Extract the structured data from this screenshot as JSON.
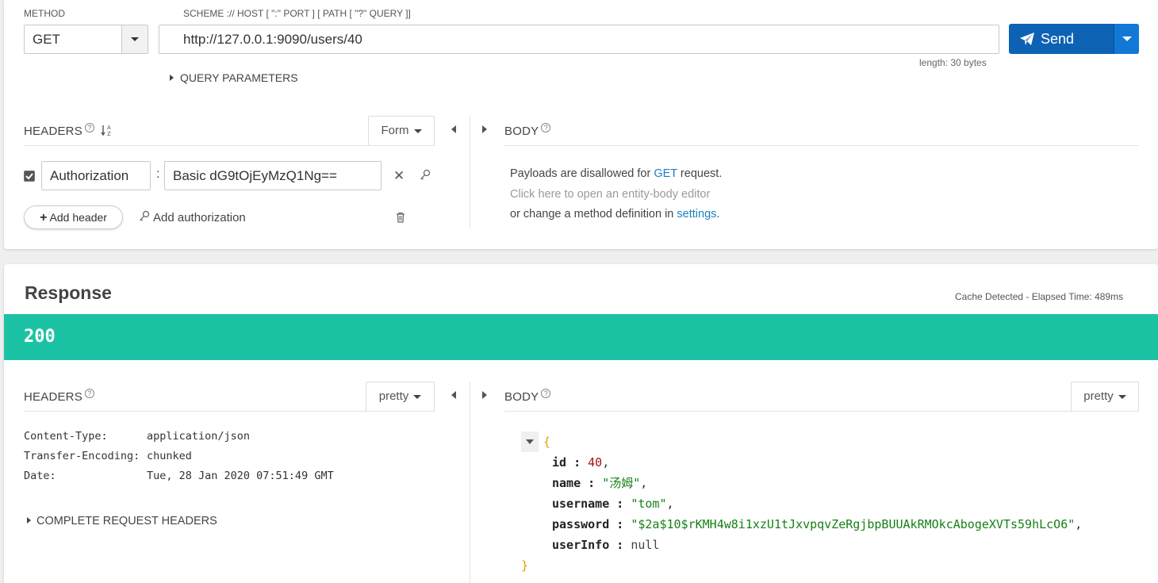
{
  "request": {
    "method_label": "METHOD",
    "method_value": "GET",
    "url_label": "SCHEME :// HOST [ \":\" PORT ] [ PATH [ \"?\" QUERY ]]",
    "url_value": "http://127.0.0.1:9090/users/40",
    "url_length": "length: 30 bytes",
    "send_label": "Send",
    "query_params_label": "QUERY PARAMETERS",
    "headers_title": "HEADERS",
    "headers_mode": "Form",
    "header_row": {
      "name": "Authorization",
      "separator": ":",
      "value": "Basic dG9tOjEyMzQ1Ng=="
    },
    "add_header_label": "Add header",
    "add_auth_label": "Add authorization",
    "body_title": "BODY",
    "body_msg": {
      "line1_pre": "Payloads are disallowed for ",
      "line1_method": "GET",
      "line1_post": " request.",
      "line2": "Click here to open an entity-body editor",
      "line3_pre": "or change a method definition in ",
      "line3_link": "settings",
      "line3_post": "."
    }
  },
  "response": {
    "title": "Response",
    "meta": "Cache Detected - Elapsed Time: 489ms",
    "status_code": "200",
    "status_color": "#1bc3a4",
    "headers_title": "HEADERS",
    "headers_mode": "pretty",
    "body_title": "BODY",
    "body_mode": "pretty",
    "headers": [
      {
        "name": "Content-Type:",
        "value": "application/json"
      },
      {
        "name": "Transfer-Encoding:",
        "value": "chunked"
      },
      {
        "name": "Date:",
        "value": "Tue, 28 Jan 2020 07:51:49 GMT"
      }
    ],
    "complete_request_headers_label": "COMPLETE REQUEST HEADERS",
    "json": {
      "open": "{",
      "close": "}",
      "fields": [
        {
          "key": "id",
          "value": "40",
          "type": "num",
          "comma": ","
        },
        {
          "key": "name",
          "value": "\"汤姆\"",
          "type": "str",
          "comma": ","
        },
        {
          "key": "username",
          "value": "\"tom\"",
          "type": "str",
          "comma": ","
        },
        {
          "key": "password",
          "value": "\"$2a$10$rKMH4w8i1xzU1tJxvpqvZeRgjbpBUUAkRMOkcAbogeXVTs59hLcO6\"",
          "type": "str",
          "comma": ","
        },
        {
          "key": "userInfo",
          "value": "null",
          "type": "null",
          "comma": ""
        }
      ]
    }
  },
  "colors": {
    "accent": "#0d62b3",
    "link": "#1a7fc1",
    "status_ok": "#1bc3a4"
  }
}
